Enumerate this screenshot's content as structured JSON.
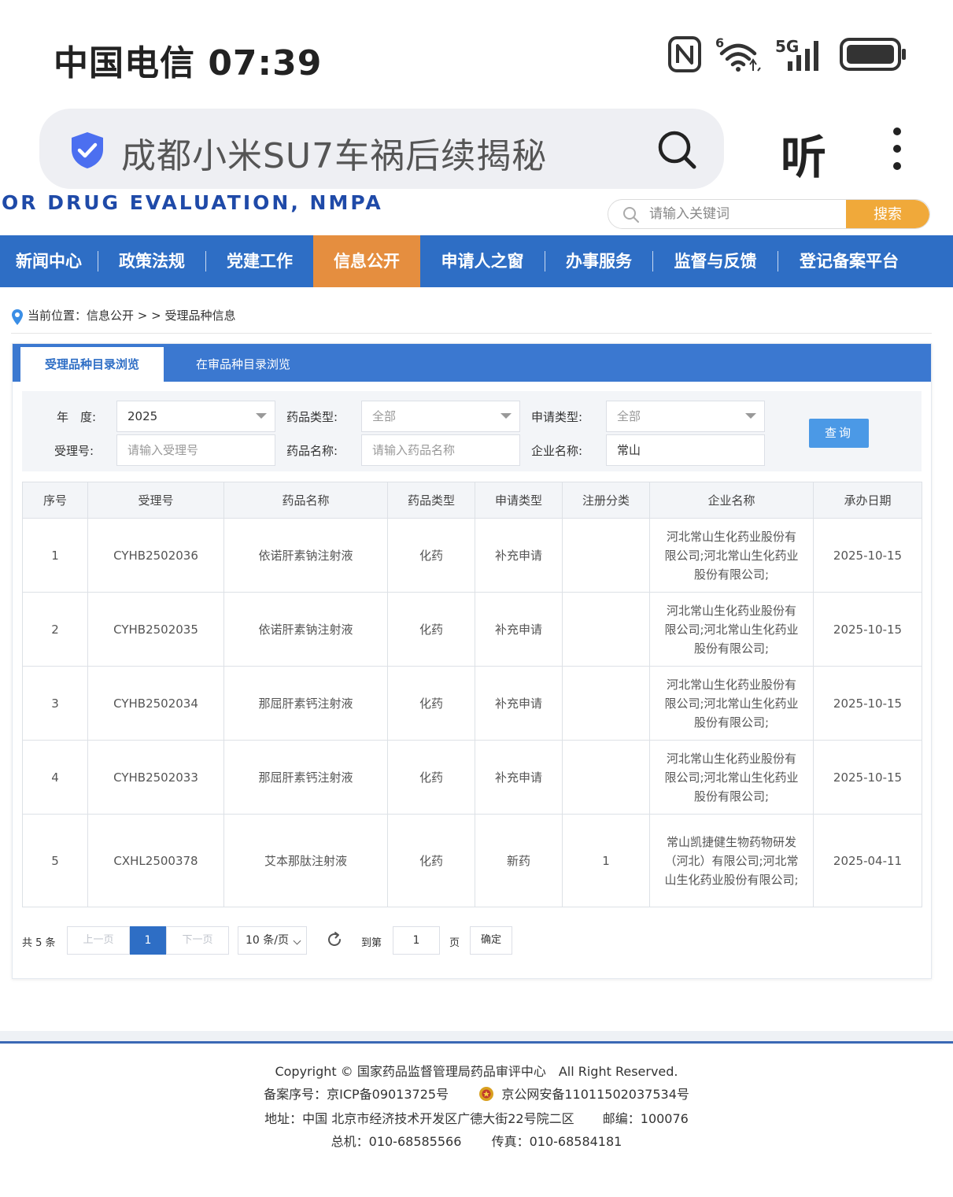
{
  "status": {
    "carrier_time": "中国电信 07:39"
  },
  "browser": {
    "search_text": "成都小米SU7车祸后续揭秘",
    "listen_label": "听"
  },
  "site": {
    "logo_text": "OR DRUG EVALUATION, NMPA",
    "search_placeholder": "请输入关键词",
    "search_button": "搜索"
  },
  "nav": {
    "items": [
      {
        "label": "新闻中心"
      },
      {
        "label": "政策法规"
      },
      {
        "label": "党建工作"
      },
      {
        "label": "信息公开"
      },
      {
        "label": "申请人之窗"
      },
      {
        "label": "办事服务"
      },
      {
        "label": "监督与反馈"
      },
      {
        "label": "登记备案平台"
      }
    ],
    "active_index": 3
  },
  "breadcrumb": {
    "text": "当前位置：信息公开 > > 受理品种信息"
  },
  "tabs": [
    {
      "label": "受理品种目录浏览"
    },
    {
      "label": "在审品种目录浏览"
    }
  ],
  "filters": {
    "year_label": "年　度:",
    "year_value": "2025",
    "drug_type_label": "药品类型:",
    "drug_type_value": "全部",
    "apply_type_label": "申请类型:",
    "apply_type_value": "全部",
    "accept_no_label": "受理号:",
    "accept_no_placeholder": "请输入受理号",
    "drug_name_label": "药品名称:",
    "drug_name_placeholder": "请输入药品名称",
    "company_label": "企业名称:",
    "company_value": "常山",
    "query_button": "查询"
  },
  "table": {
    "headers": [
      "序号",
      "受理号",
      "药品名称",
      "药品类型",
      "申请类型",
      "注册分类",
      "企业名称",
      "承办日期"
    ],
    "rows": [
      {
        "no": "1",
        "accept_no": "CYHB2502036",
        "drug": "依诺肝素钠注射液",
        "type": "化药",
        "apply": "补充申请",
        "reg": "",
        "company": "河北常山生化药业股份有限公司;河北常山生化药业股份有限公司;",
        "date": "2025-10-15"
      },
      {
        "no": "2",
        "accept_no": "CYHB2502035",
        "drug": "依诺肝素钠注射液",
        "type": "化药",
        "apply": "补充申请",
        "reg": "",
        "company": "河北常山生化药业股份有限公司;河北常山生化药业股份有限公司;",
        "date": "2025-10-15"
      },
      {
        "no": "3",
        "accept_no": "CYHB2502034",
        "drug": "那屈肝素钙注射液",
        "type": "化药",
        "apply": "补充申请",
        "reg": "",
        "company": "河北常山生化药业股份有限公司;河北常山生化药业股份有限公司;",
        "date": "2025-10-15"
      },
      {
        "no": "4",
        "accept_no": "CYHB2502033",
        "drug": "那屈肝素钙注射液",
        "type": "化药",
        "apply": "补充申请",
        "reg": "",
        "company": "河北常山生化药业股份有限公司;河北常山生化药业股份有限公司;",
        "date": "2025-10-15"
      },
      {
        "no": "5",
        "accept_no": "CXHL2500378",
        "drug": "艾本那肽注射液",
        "type": "化药",
        "apply": "新药",
        "reg": "1",
        "company": "常山凯捷健生物药物研发（河北）有限公司;河北常山生化药业股份有限公司;",
        "date": "2025-04-11"
      }
    ]
  },
  "pager": {
    "total": "共 5 条",
    "prev": "上一页",
    "current": "1",
    "next": "下一页",
    "page_size": "10 条/页",
    "goto_label": "到第",
    "goto_value": "1",
    "page_label": "页",
    "confirm": "确定"
  },
  "footer": {
    "copyright": "Copyright © 国家药品监督管理局药品审评中心　All Right Reserved.",
    "icp": "备案序号：京ICP备09013725号",
    "police": "京公网安备11011502037534号",
    "address": "地址：中国 北京市经济技术开发区广德大街22号院二区",
    "postcode": "邮编：100076",
    "phone": "总机：010-68585566",
    "fax": "传真：010-68584181"
  },
  "colors": {
    "nav": "#2e6ec5",
    "nav_active": "#e58e3f",
    "search_button": "#f0a93a",
    "query_button": "#4b99e6"
  }
}
